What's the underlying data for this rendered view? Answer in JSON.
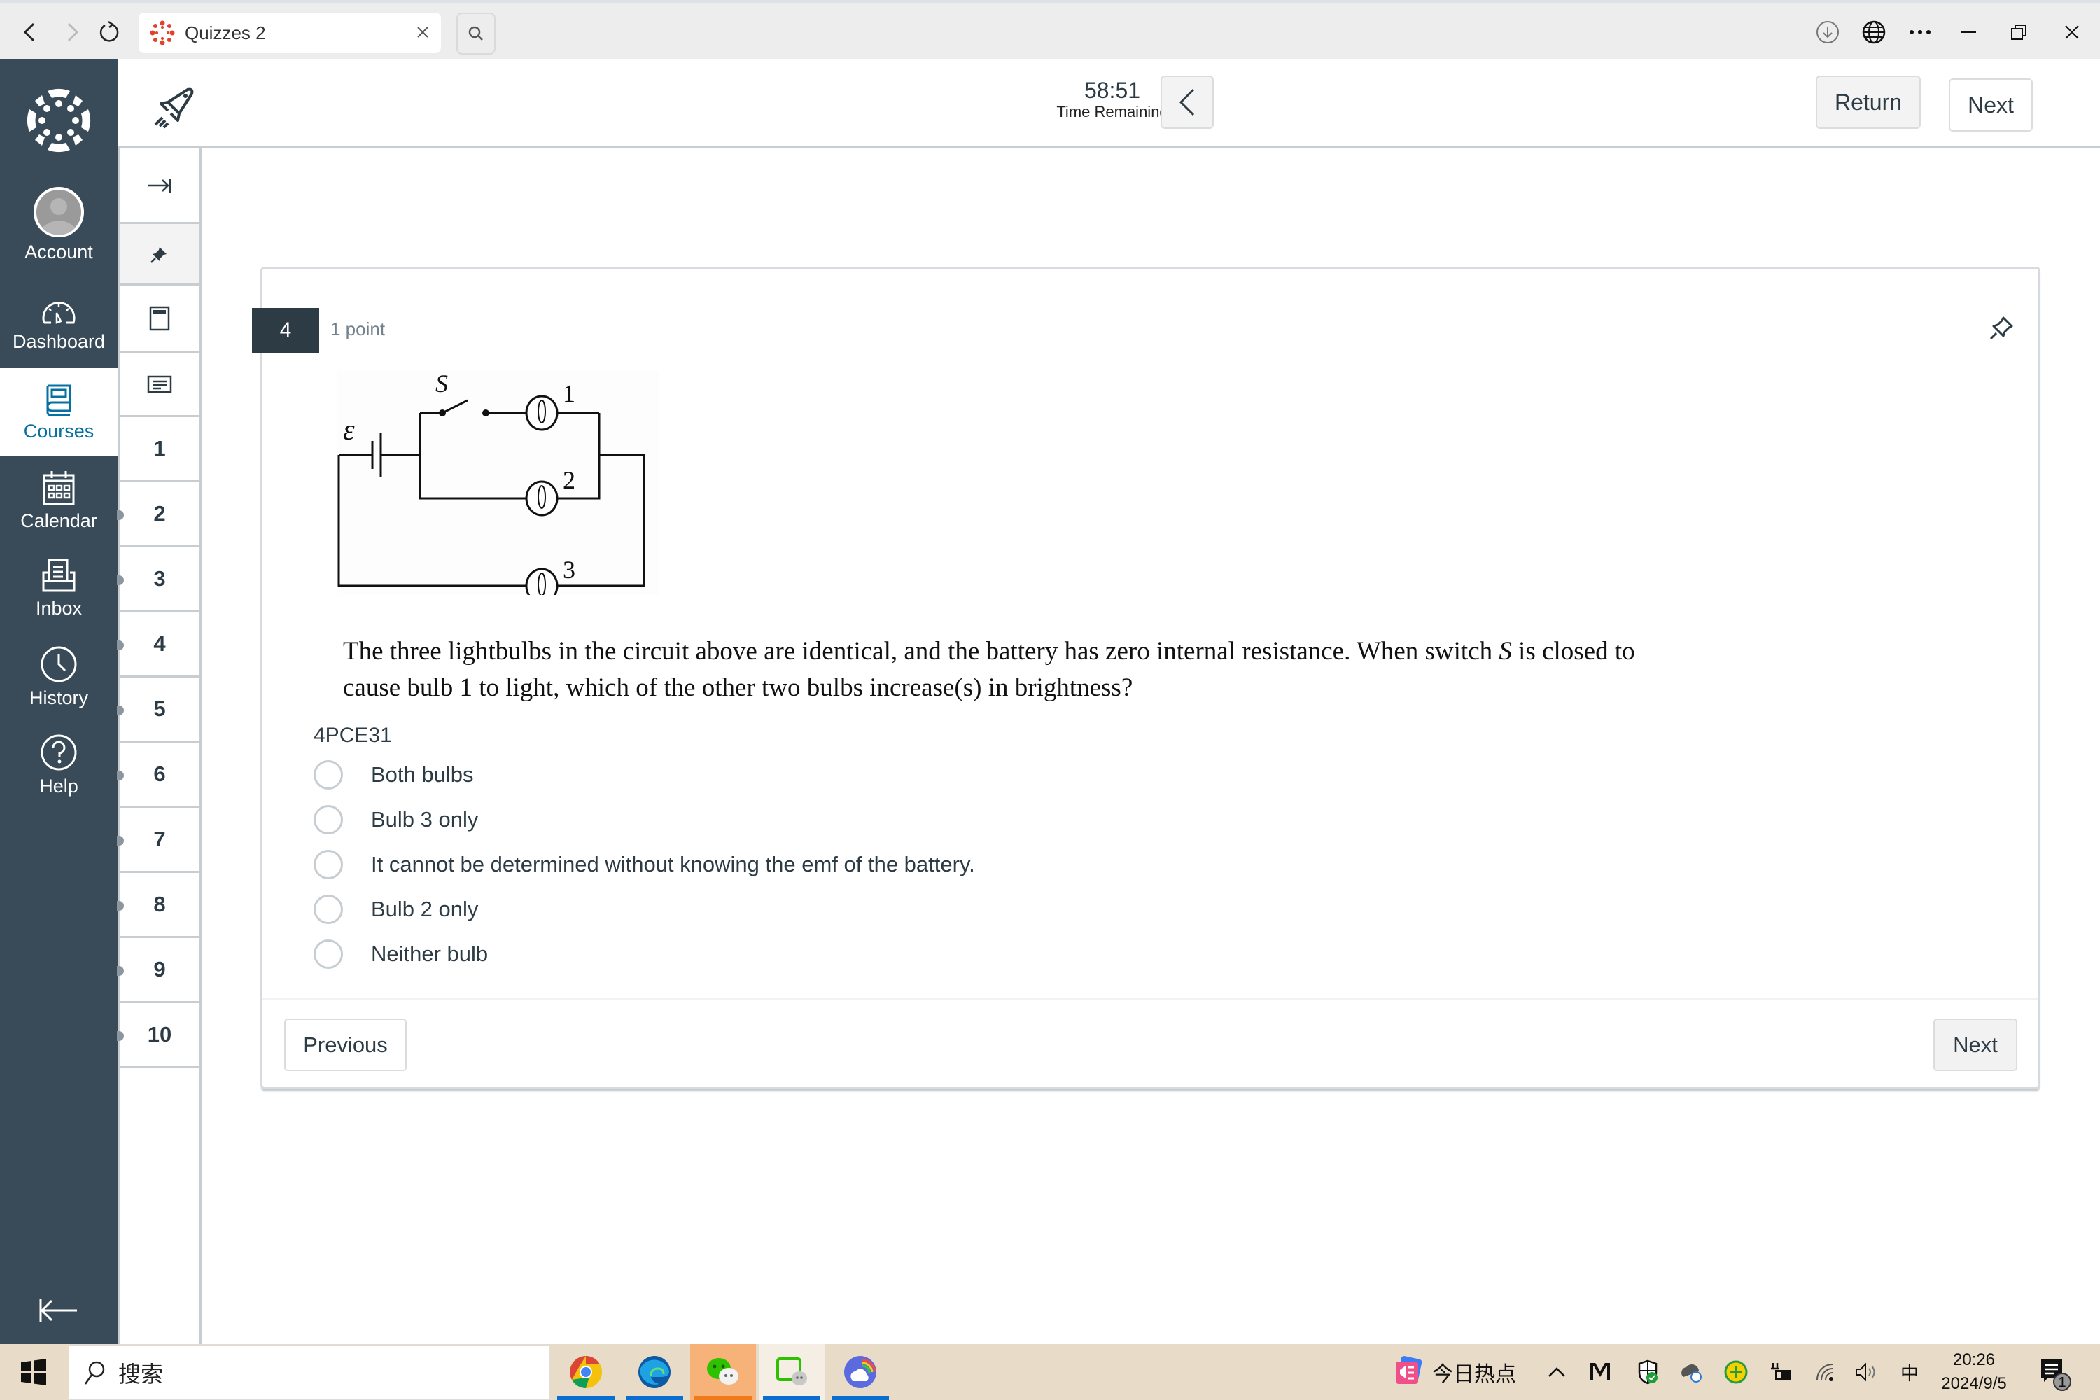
{
  "browser": {
    "tab_title": "Quizzes 2",
    "back_icon": "chevron-left-icon",
    "forward_icon": "chevron-right-icon",
    "refresh_icon": "refresh-icon",
    "close_tab_icon": "close-icon",
    "search_icon": "search-icon",
    "right_icons": [
      "download-icon",
      "globe-icon",
      "more-icon",
      "minimize-icon",
      "restore-icon",
      "close-icon"
    ]
  },
  "global_nav": {
    "items": [
      {
        "label": "Account",
        "icon": "avatar-icon",
        "active": false
      },
      {
        "label": "Dashboard",
        "icon": "dashboard-gauge-icon",
        "active": false
      },
      {
        "label": "Courses",
        "icon": "courses-book-icon",
        "active": true
      },
      {
        "label": "Calendar",
        "icon": "calendar-icon",
        "active": false
      },
      {
        "label": "Inbox",
        "icon": "inbox-icon",
        "active": false
      },
      {
        "label": "History",
        "icon": "clock-icon",
        "active": false
      },
      {
        "label": "Help",
        "icon": "help-icon",
        "active": false
      }
    ],
    "accent_color": "#0770A3",
    "background_color": "#394B58"
  },
  "header": {
    "timer_value": "58:51",
    "timer_label": "Time Remaining",
    "return_label": "Return",
    "next_label": "Next"
  },
  "question_nav": {
    "tools": [
      "expand-icon",
      "pin-icon",
      "calculator-icon",
      "notes-icon"
    ],
    "questions": [
      "1",
      "2",
      "3",
      "4",
      "5",
      "6",
      "7",
      "8",
      "9",
      "10"
    ]
  },
  "question": {
    "number": "4",
    "points": "1 point",
    "text_part1": "The three lightbulbs in the circuit above are identical, and the battery has zero internal resistance. When switch ",
    "text_switch": "S",
    "text_part2": " is closed to cause bulb 1 to light, which of the other two bulbs increase(s) in brightness?",
    "code": "4PCE31",
    "circuit_labels": {
      "emf": "ε",
      "switch": "S",
      "bulb1": "1",
      "bulb2": "2",
      "bulb3": "3"
    },
    "options": [
      "Both bulbs",
      "Bulb 3 only",
      "It cannot be determined without knowing the emf of the battery.",
      "Bulb 2 only",
      "Neither bulb"
    ],
    "previous_label": "Previous",
    "next_label": "Next"
  },
  "taskbar": {
    "search_label": "搜索",
    "apps": [
      "chrome-icon",
      "edge-icon",
      "wechat-icon",
      "wechat-work-icon",
      "cloud-app-icon"
    ],
    "news_label": "今日热点",
    "ime_label": "中",
    "time": "20:26",
    "date": "2024/9/5",
    "notification_count": "1"
  }
}
